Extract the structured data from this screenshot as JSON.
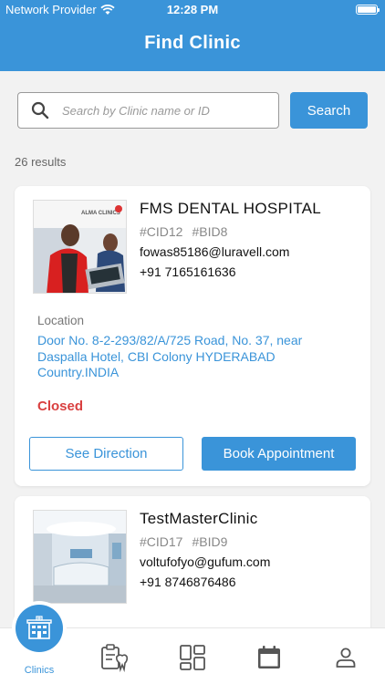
{
  "status_bar": {
    "provider": "Network Provider",
    "time": "12:28 PM"
  },
  "header": {
    "title": "Find Clinic"
  },
  "search": {
    "placeholder": "Search by Clinic name or ID",
    "button_label": "Search"
  },
  "results_count": "26 results",
  "clinics": [
    {
      "name": "FMS DENTAL HOSPITAL",
      "cid": "#CID12",
      "bid": "#BID8",
      "email": "fowas85186@luravell.com",
      "phone": "+91 7165161636",
      "location_label": "Location",
      "address": "Door No. 8-2-293/82/A/725 Road, No. 37, near Daspalla Hotel, CBI Colony HYDERABAD Country.INDIA",
      "status": "Closed",
      "direction_label": "See Direction",
      "book_label": "Book Appointment",
      "photo_sign": "ALMA CLINICS"
    },
    {
      "name": "TestMasterClinic",
      "cid": "#CID17",
      "bid": "#BID9",
      "email": "voltufofyo@gufum.com",
      "phone": "+91 8746876486"
    }
  ],
  "tabbar": {
    "active_label": "Clinics",
    "icons": [
      "clinic-icon",
      "dental-records-icon",
      "dashboard-icon",
      "calendar-icon",
      "profile-icon"
    ]
  },
  "colors": {
    "accent": "#3a94d9",
    "closed": "#d94040"
  }
}
